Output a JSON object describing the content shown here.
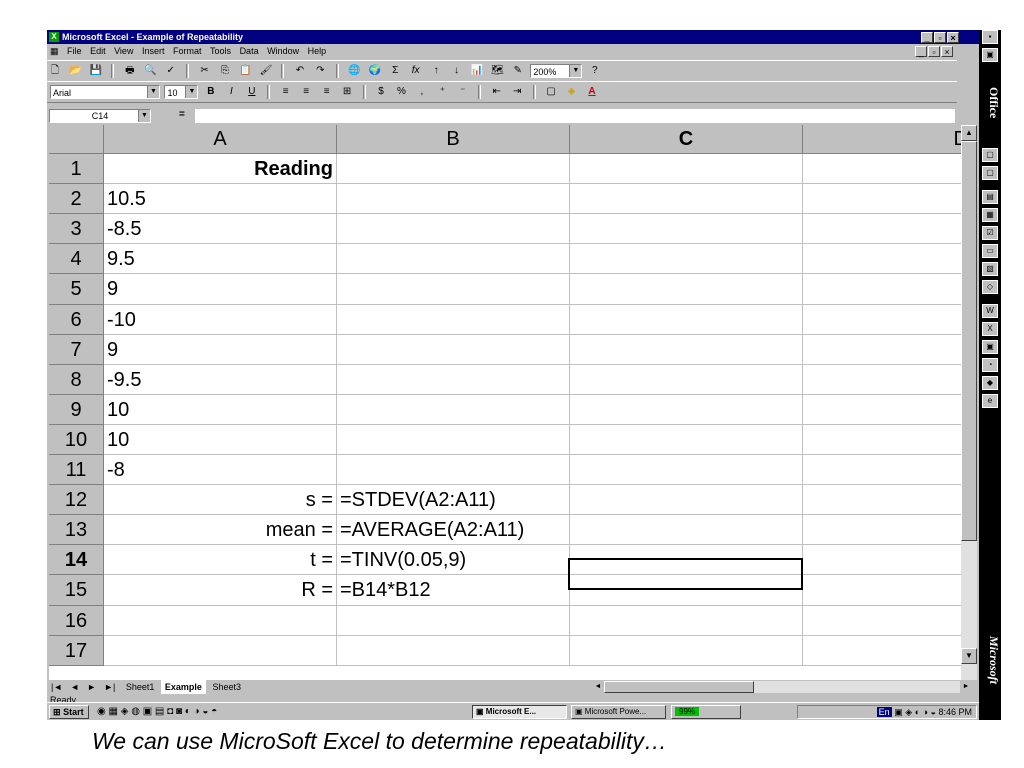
{
  "window": {
    "title": "Microsoft Excel - Example of Repeatability",
    "app_icon": "excel-icon",
    "buttons": [
      "_",
      "▫",
      "×"
    ]
  },
  "menubar": {
    "items": [
      "File",
      "Edit",
      "View",
      "Insert",
      "Format",
      "Tools",
      "Data",
      "Window",
      "Help"
    ]
  },
  "toolbar": {
    "zoom": "200%",
    "font_name": "Arial",
    "font_size": "10",
    "bold": "B",
    "italic": "I",
    "underline": "U",
    "sum": "Σ",
    "fx": "fx",
    "currency": "$",
    "percent": "%",
    "comma": ","
  },
  "formula_bar": {
    "name_box": "C14",
    "equals": "=",
    "content": ""
  },
  "grid": {
    "columns": [
      "A",
      "B",
      "C",
      "D"
    ],
    "rows": [
      {
        "num": "1",
        "a": "Reading",
        "b": ""
      },
      {
        "num": "2",
        "a": "10.5",
        "b": ""
      },
      {
        "num": "3",
        "a": "-8.5",
        "b": ""
      },
      {
        "num": "4",
        "a": "9.5",
        "b": ""
      },
      {
        "num": "5",
        "a": "9",
        "b": ""
      },
      {
        "num": "6",
        "a": "-10",
        "b": ""
      },
      {
        "num": "7",
        "a": "9",
        "b": ""
      },
      {
        "num": "8",
        "a": "-9.5",
        "b": ""
      },
      {
        "num": "9",
        "a": "10",
        "b": ""
      },
      {
        "num": "10",
        "a": "10",
        "b": ""
      },
      {
        "num": "11",
        "a": "-8",
        "b": ""
      },
      {
        "num": "12",
        "a": "s =",
        "b": "=STDEV(A2:A11)"
      },
      {
        "num": "13",
        "a": "mean =",
        "b": "=AVERAGE(A2:A11)"
      },
      {
        "num": "14",
        "a": "t =",
        "b": "=TINV(0.05,9)"
      },
      {
        "num": "15",
        "a": "R =",
        "b": "=B14*B12"
      },
      {
        "num": "16",
        "a": "",
        "b": ""
      },
      {
        "num": "17",
        "a": "",
        "b": ""
      }
    ],
    "selected_cell": "C14"
  },
  "sheet_tabs": [
    "Sheet1",
    "Example",
    "Sheet3"
  ],
  "active_sheet": "Example",
  "status": "Ready",
  "taskbar": {
    "start": "Start",
    "tasks": [
      "Microsoft E...",
      "Microsoft Powe...",
      "99%"
    ],
    "clock": "8:46 PM",
    "lang": "En"
  },
  "office_bar": {
    "top_label": "Office",
    "bottom_label": "Microsoft"
  },
  "caption": "We can use MicroSoft Excel to determine repeatability…"
}
